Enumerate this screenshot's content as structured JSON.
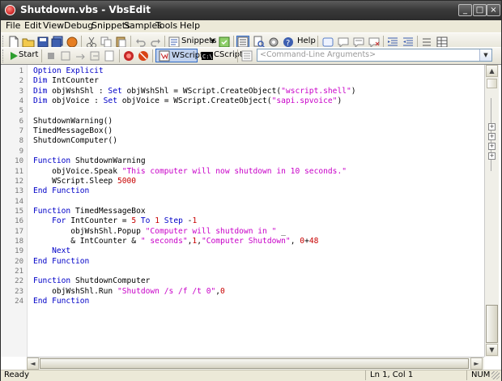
{
  "window": {
    "title": "Shutdown.vbs - VbsEdit"
  },
  "menu": [
    "File",
    "Edit",
    "View",
    "Debug",
    "Snippets",
    "Samples",
    "Tools",
    "Help"
  ],
  "toolbar1": {
    "snippets_label": "Snippets",
    "help_label": "Help"
  },
  "toolbar2": {
    "start_label": "Start",
    "wscript_label": "WScript",
    "cscript_label": "CScript",
    "args_placeholder": "<Command-Line Arguments>"
  },
  "editor": {
    "line_numbers": [
      "1",
      "2",
      "3",
      "4",
      "5",
      "6",
      "7",
      "8",
      "9",
      "10",
      "11",
      "12",
      "13",
      "14",
      "15",
      "16",
      "17",
      "18",
      "19",
      "20",
      "21",
      "22",
      "23",
      "24"
    ],
    "lines": [
      "Option Explicit",
      "Dim IntCounter",
      "Dim objWshShl : Set objWshShl = WScript.CreateObject(\"wscript.shell\")",
      "Dim objVoice : Set objVoice = WScript.CreateObject(\"sapi.spvoice\")",
      "",
      "ShutdownWarning()",
      "TimedMessageBox()",
      "ShutdownComputer()",
      "",
      "Function ShutdownWarning",
      "    objVoice.Speak \"This computer will now shutdown in 10 seconds.\"",
      "    WScript.Sleep 5000",
      "End Function",
      "",
      "Function TimedMessageBox",
      "    For IntCounter = 5 To 1 Step -1",
      "        objWshShl.Popup \"Computer will shutdown in \" _",
      "        & IntCounter & \" seconds\",1,\"Computer Shutdown\", 0+48",
      "    Next",
      "End Function",
      "",
      "Function ShutdownComputer",
      "    objWshShl.Run \"Shutdown /s /f /t 0\",0",
      "End Function"
    ]
  },
  "status": {
    "ready": "Ready",
    "position": "Ln 1, Col 1",
    "num": "NUM"
  }
}
